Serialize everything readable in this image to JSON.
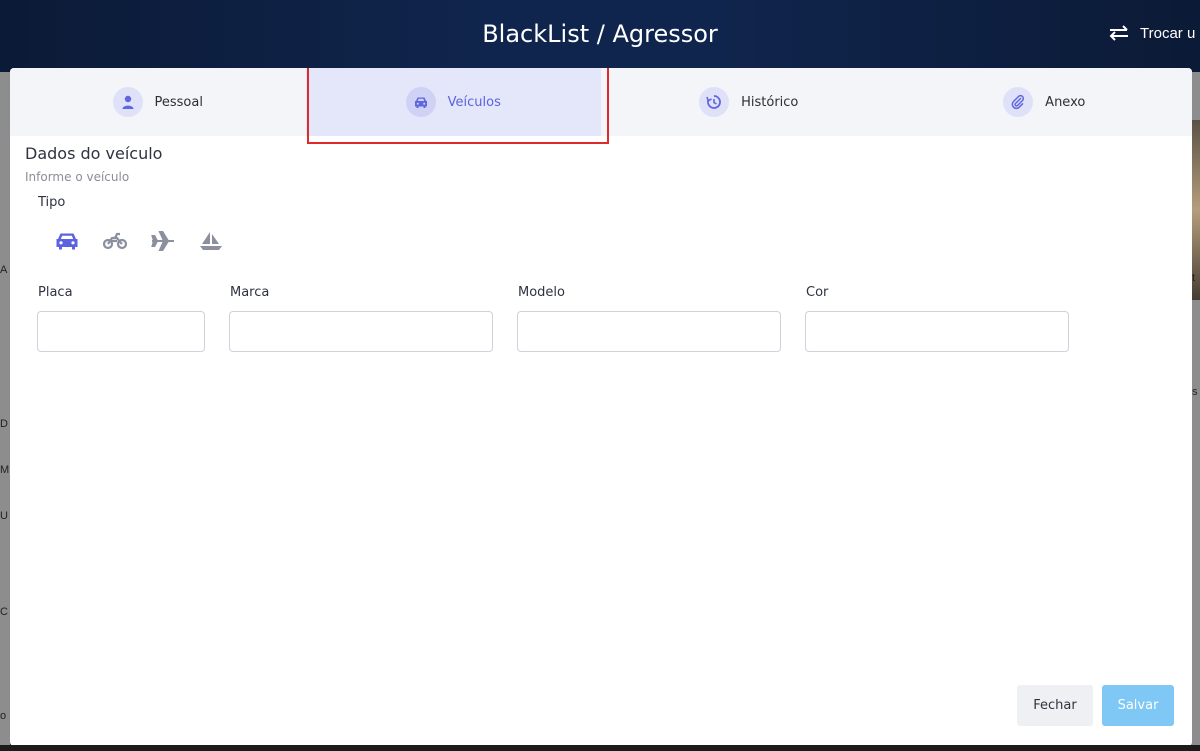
{
  "header": {
    "title": "BlackList / Agressor",
    "switch_label": "Trocar u"
  },
  "background_fragments": [
    "A",
    "D",
    "M",
    "U",
    "C",
    "o",
    "t",
    "s"
  ],
  "tabs": [
    {
      "label": "Pessoal",
      "icon": "user-icon",
      "active": false
    },
    {
      "label": "Veículos",
      "icon": "car-icon",
      "active": true
    },
    {
      "label": "Histórico",
      "icon": "history-icon",
      "active": false
    },
    {
      "label": "Anexo",
      "icon": "paperclip-icon",
      "active": false
    }
  ],
  "section": {
    "title": "Dados do veículo",
    "subtitle": "Informe o veículo",
    "tipo_label": "Tipo"
  },
  "vehicle_types": [
    {
      "name": "car-icon",
      "selected": true
    },
    {
      "name": "motorcycle-icon",
      "selected": false
    },
    {
      "name": "airplane-icon",
      "selected": false
    },
    {
      "name": "boat-icon",
      "selected": false
    }
  ],
  "fields": {
    "placa": {
      "label": "Placa",
      "value": ""
    },
    "marca": {
      "label": "Marca",
      "value": ""
    },
    "modelo": {
      "label": "Modelo",
      "value": ""
    },
    "cor": {
      "label": "Cor",
      "value": ""
    }
  },
  "buttons": {
    "close": "Fechar",
    "save": "Salvar"
  },
  "colors": {
    "accent": "#5b63e0",
    "icon_inactive": "#8c8fa0",
    "save_button": "#7fc7f5",
    "highlight": "#e02a2a",
    "header_bg": "#10254d"
  }
}
